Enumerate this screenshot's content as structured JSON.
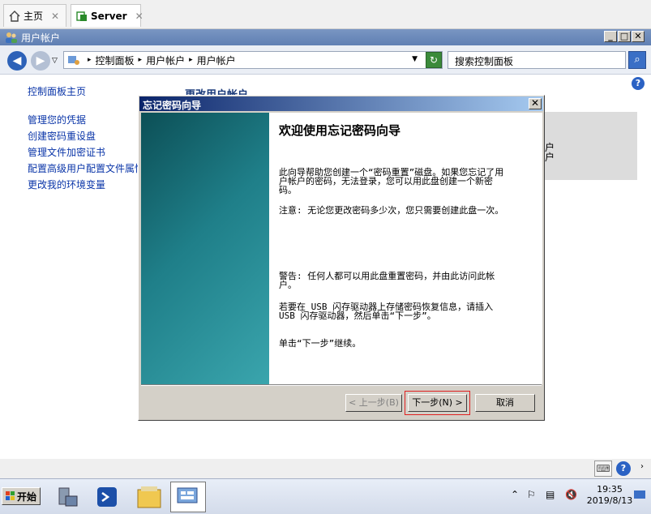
{
  "browser": {
    "tabs": [
      {
        "label": "主页",
        "close": "✕"
      },
      {
        "label": "Server",
        "close": "✕"
      }
    ]
  },
  "window": {
    "title": "用户帐户",
    "minimize": "_",
    "maximize": "□",
    "close": "✕"
  },
  "address_bar": {
    "breadcrumb": [
      "控制面板",
      "用户帐户",
      "用户帐户"
    ],
    "search_placeholder": "搜索控制面板"
  },
  "left_nav": {
    "home": "控制面板主页",
    "links": [
      "管理您的凭据",
      "创建密码重设盘",
      "管理文件加密证书",
      "配置高级用户配置文件属性",
      "更改我的环境变量"
    ]
  },
  "main": {
    "heading": "更改用户帐户",
    "right_panel_text": "户\n户"
  },
  "dialog": {
    "title": "忘记密码向导",
    "heading": "欢迎使用忘记密码向导",
    "paragraphs": [
      "此向导帮助您创建一个“密码重置”磁盘。如果您忘记了用户帐户的密码，无法登录，您可以用此盘创建一个新密码。",
      "注意: 无论您更改密码多少次，您只需要创建此盘一次。",
      "警告: 任何人都可以用此盘重置密码，并由此访问此帐户。",
      "若要在 USB 闪存驱动器上存储密码恢复信息，请插入 USB 闪存驱动器，然后单击“下一步”。",
      "单击“下一步”继续。"
    ],
    "buttons": {
      "back": "< 上一步(B)",
      "next": "下一步(N) >",
      "cancel": "取消"
    }
  },
  "taskbar": {
    "start": "开始",
    "time": "19:35",
    "date": "2019/8/13"
  }
}
